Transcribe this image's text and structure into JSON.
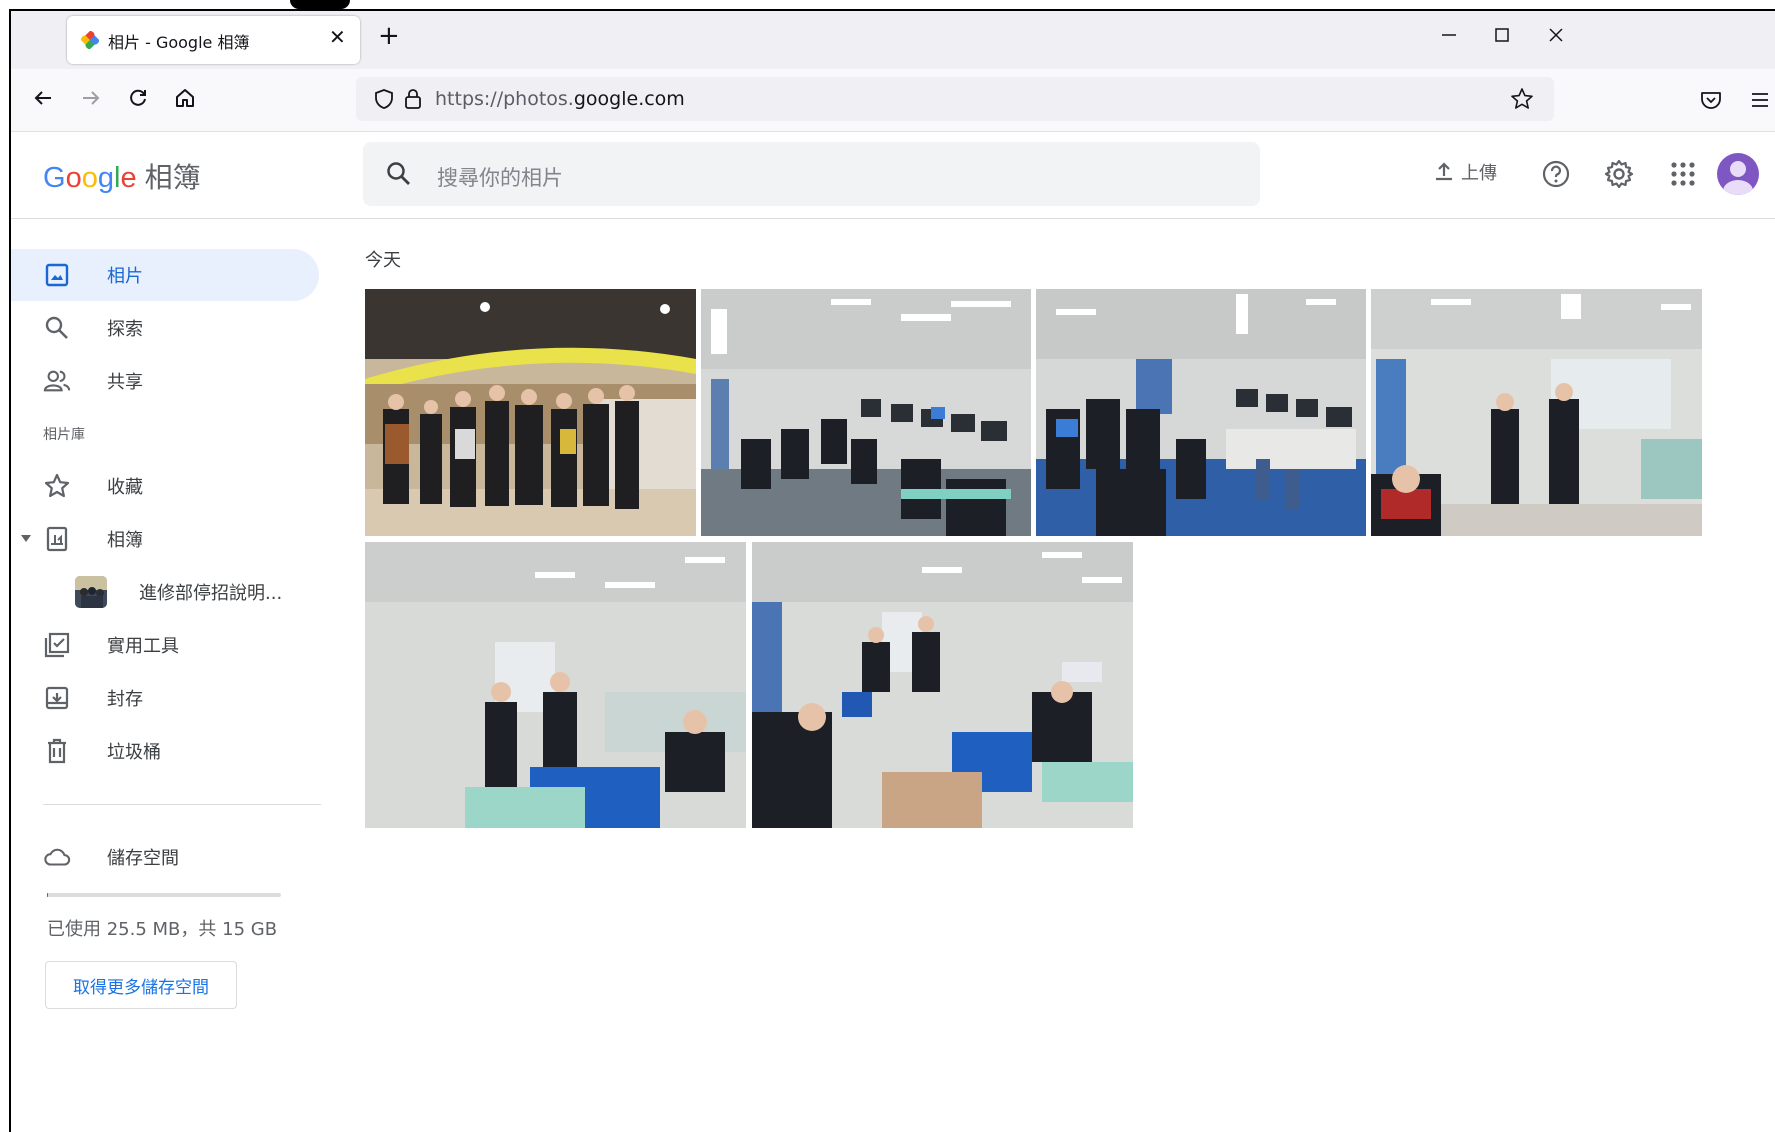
{
  "browser": {
    "tab_title": "相片 - Google 相簿",
    "url_prefix": "https://photos.",
    "url_domain": "google.com"
  },
  "app": {
    "logo_text": "Google",
    "product_name": "相簿",
    "search_placeholder": "搜尋你的相片",
    "upload_label": "上傳"
  },
  "sidebar": {
    "items": [
      {
        "label": "相片",
        "icon": "photo-icon",
        "active": true
      },
      {
        "label": "探索",
        "icon": "search-icon"
      },
      {
        "label": "共享",
        "icon": "people-icon"
      }
    ],
    "library_label": "相片庫",
    "library_items": [
      {
        "label": "收藏",
        "icon": "star-icon"
      },
      {
        "label": "相簿",
        "icon": "album-icon"
      }
    ],
    "album": {
      "label": "進修部停招說明..."
    },
    "more_items": [
      {
        "label": "實用工具",
        "icon": "utilities-icon"
      },
      {
        "label": "封存",
        "icon": "archive-icon"
      },
      {
        "label": "垃圾桶",
        "icon": "trash-icon"
      }
    ],
    "storage": {
      "label": "儲存空間",
      "usage_text": "已使用 25.5 MB，共 15 GB",
      "usage_fraction": 0.0017,
      "button": "取得更多儲存空間"
    }
  },
  "content": {
    "day_label": "今天",
    "photo_count": 6
  },
  "colors": {
    "accent": "#1a73e8",
    "active_bg": "#e8f0fe",
    "avatar": "#7e57c2"
  }
}
